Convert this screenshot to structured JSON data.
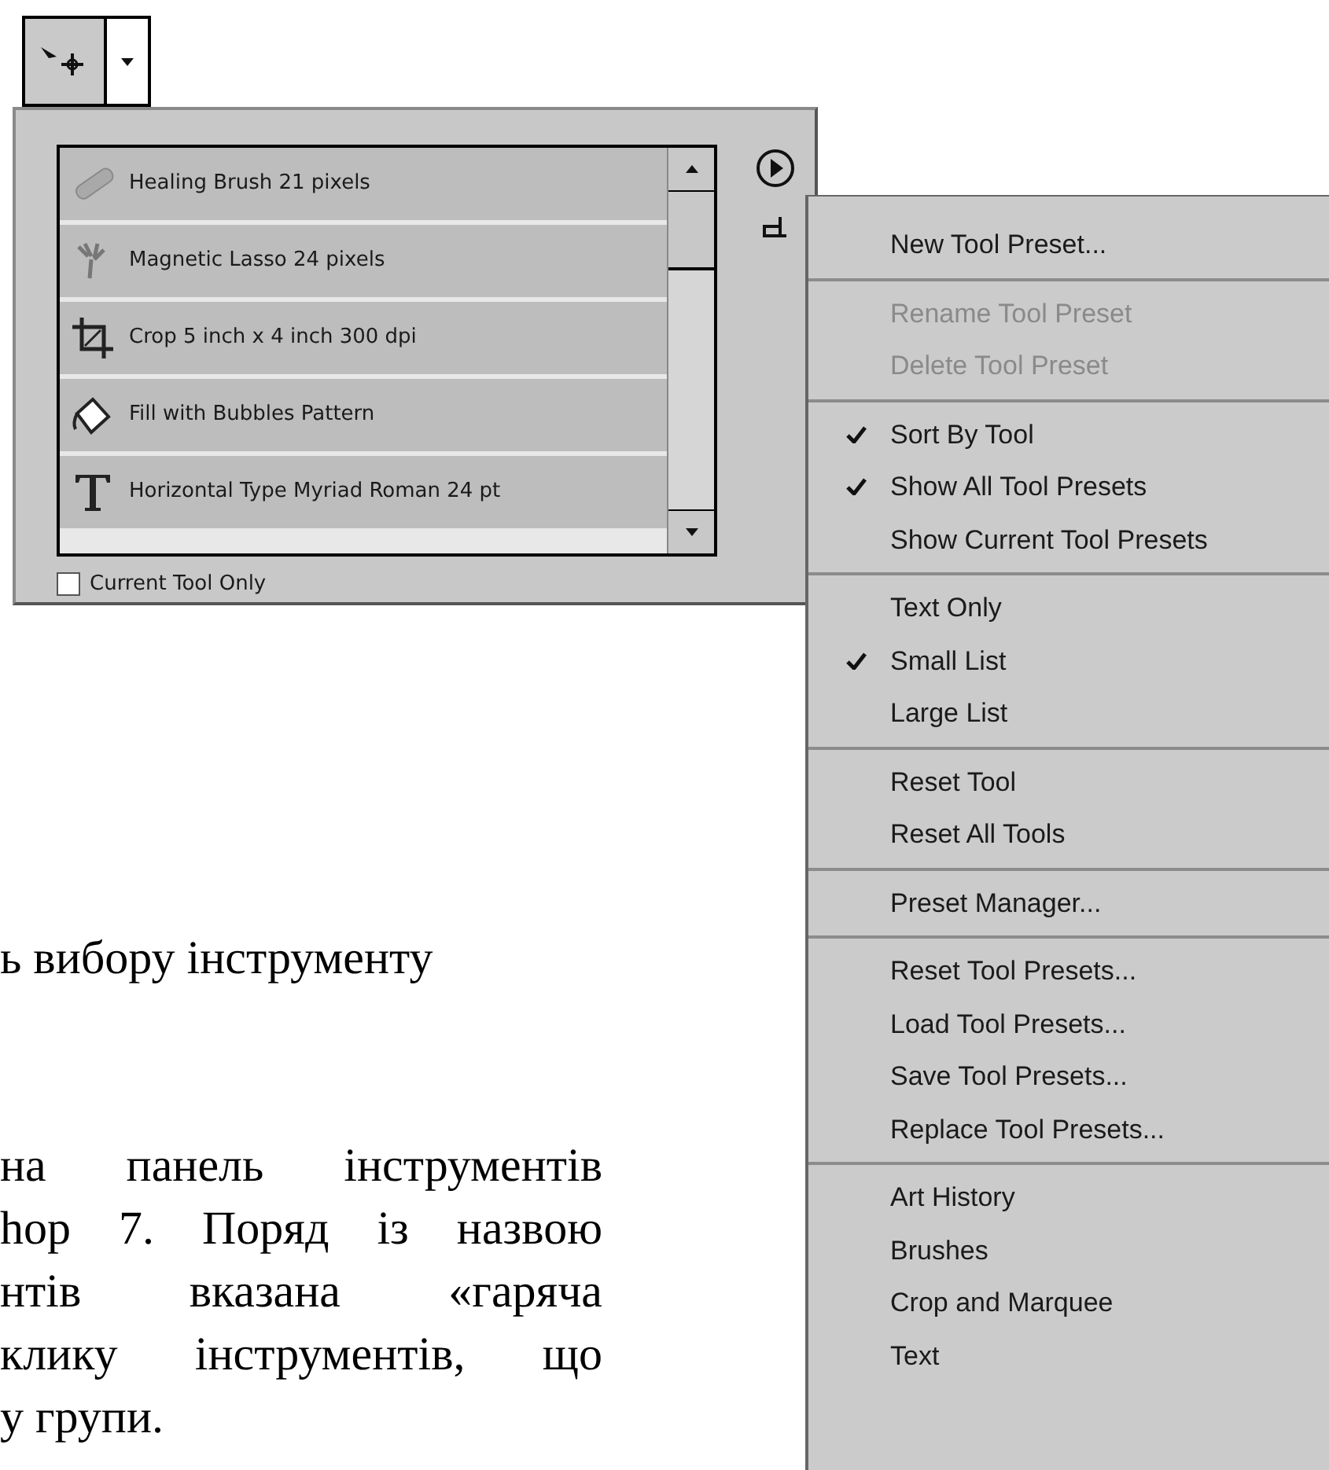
{
  "presets": [
    {
      "label": "Healing Brush 21 pixels"
    },
    {
      "label": "Magnetic Lasso 24 pixels"
    },
    {
      "label": "Crop 5 inch x 4 inch 300 dpi"
    },
    {
      "label": "Fill with Bubbles Pattern"
    },
    {
      "label": "Horizontal Type Myriad Roman 24 pt"
    }
  ],
  "current_tool_only": {
    "label": "Current Tool Only",
    "checked": false
  },
  "menu": {
    "groups": [
      [
        {
          "label": "New Tool Preset...",
          "checked": false,
          "disabled": false
        }
      ],
      [
        {
          "label": "Rename Tool Preset",
          "checked": false,
          "disabled": true
        },
        {
          "label": "Delete Tool Preset",
          "checked": false,
          "disabled": true
        }
      ],
      [
        {
          "label": "Sort By Tool",
          "checked": true,
          "disabled": false
        },
        {
          "label": "Show All Tool Presets",
          "checked": true,
          "disabled": false
        },
        {
          "label": "Show Current Tool Presets",
          "checked": false,
          "disabled": false
        }
      ],
      [
        {
          "label": "Text Only",
          "checked": false,
          "disabled": false
        },
        {
          "label": "Small List",
          "checked": true,
          "disabled": false
        },
        {
          "label": "Large List",
          "checked": false,
          "disabled": false
        }
      ],
      [
        {
          "label": "Reset Tool",
          "checked": false,
          "disabled": false
        },
        {
          "label": "Reset All Tools",
          "checked": false,
          "disabled": false
        }
      ],
      [
        {
          "label": "Preset Manager...",
          "checked": false,
          "disabled": false
        }
      ],
      [
        {
          "label": "Reset Tool Presets...",
          "checked": false,
          "disabled": false
        },
        {
          "label": "Load Tool Presets...",
          "checked": false,
          "disabled": false
        },
        {
          "label": "Save Tool Presets...",
          "checked": false,
          "disabled": false
        },
        {
          "label": "Replace Tool Presets...",
          "checked": false,
          "disabled": false
        }
      ],
      [
        {
          "label": "Art History",
          "checked": false,
          "disabled": false
        },
        {
          "label": "Brushes",
          "checked": false,
          "disabled": false
        },
        {
          "label": "Crop and Marquee",
          "checked": false,
          "disabled": false
        },
        {
          "label": "Text",
          "checked": false,
          "disabled": false
        }
      ]
    ]
  },
  "document": {
    "caption": "ь вибору інструменту",
    "paragraph": [
      "на панель інструментів",
      "hop 7. Поряд із назвою",
      "нтів вказана «гаряча",
      "клику інструментів, що",
      "у групи."
    ]
  }
}
